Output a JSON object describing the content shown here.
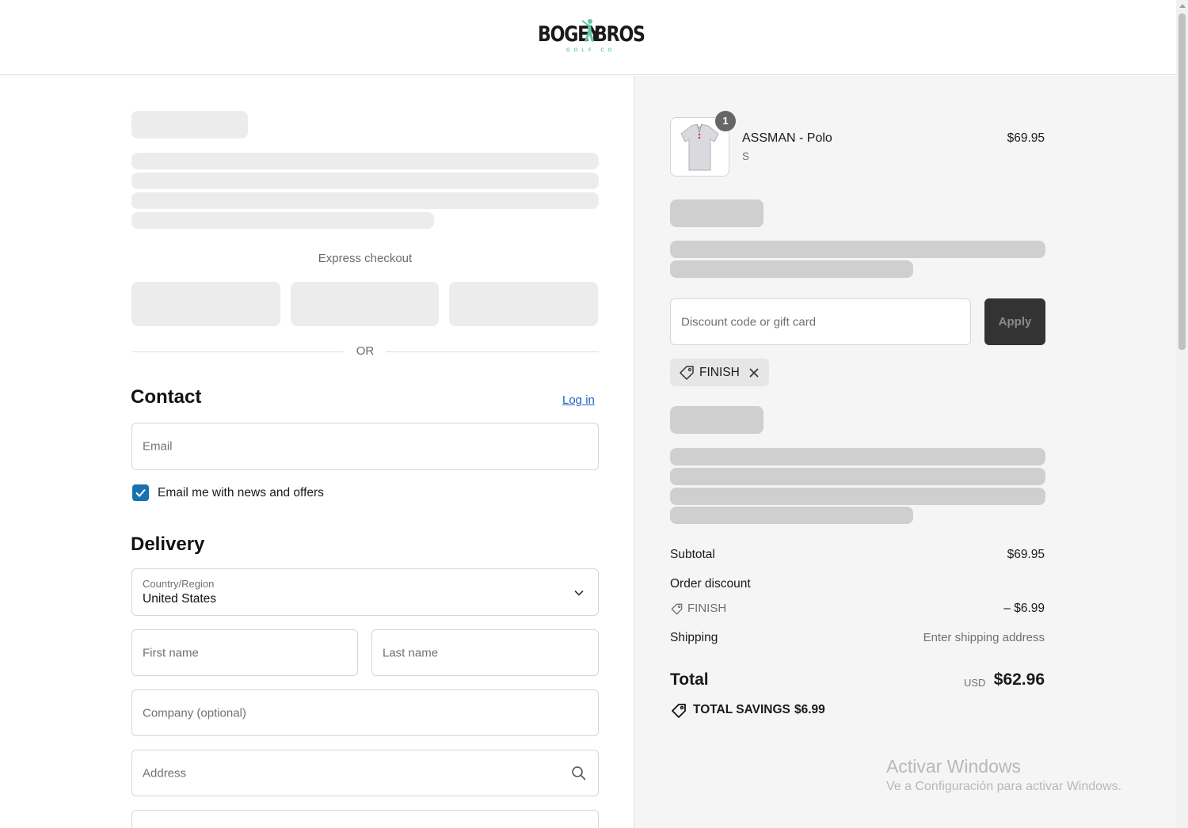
{
  "brand": {
    "name_part1": "BOGEY",
    "name_part2": "BROS",
    "tagline": "GOLF CO"
  },
  "express": {
    "label": "Express checkout",
    "or": "OR"
  },
  "contact": {
    "title": "Contact",
    "login_link": "Log in",
    "email_placeholder": "Email",
    "newsletter_label": "Email me with news and offers",
    "newsletter_checked": true
  },
  "delivery": {
    "title": "Delivery",
    "country_label": "Country/Region",
    "country_value": "United States",
    "first_name_placeholder": "First name",
    "last_name_placeholder": "Last name",
    "company_placeholder": "Company (optional)",
    "address_placeholder": "Address"
  },
  "cart": {
    "item_name": "ASSMAN - Polo",
    "item_variant": "S",
    "item_price": "$69.95",
    "item_qty": "1"
  },
  "discount": {
    "placeholder": "Discount code or gift card",
    "apply_label": "Apply",
    "applied_code": "FINISH"
  },
  "summary": {
    "subtotal_label": "Subtotal",
    "subtotal_value": "$69.95",
    "order_discount_label": "Order discount",
    "discount_code": "FINISH",
    "discount_value": "– $6.99",
    "shipping_label": "Shipping",
    "shipping_value": "Enter shipping address",
    "total_label": "Total",
    "currency": "USD",
    "total_value": "$62.96",
    "savings_label": "TOTAL SAVINGS",
    "savings_value": "$6.99"
  },
  "watermark": {
    "line1": "Activar Windows",
    "line2": "Ve a Configuración para activar Windows."
  },
  "colors": {
    "accent_link": "#1a66c7",
    "checkbox": "#1773b0",
    "brand_green": "#5fc7a6"
  }
}
